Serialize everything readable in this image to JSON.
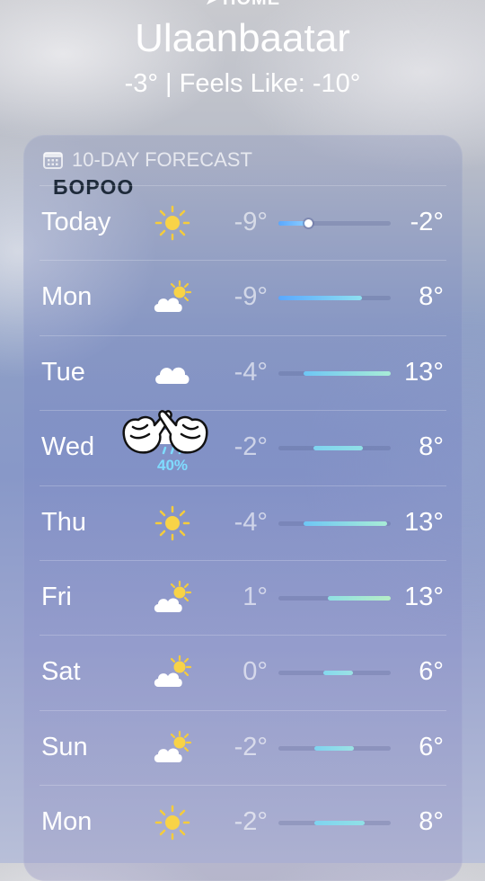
{
  "header": {
    "home_label": "HOME",
    "city": "Ulaanbaatar",
    "current": "-3° | Feels Like: -10°"
  },
  "forecast": {
    "title": "10-DAY FORECAST",
    "overlay_text": "БОРОО",
    "rows": [
      {
        "day": "Today",
        "icon": "sun-icon",
        "low": "-9°",
        "high": "-2°",
        "range_start": 0.0,
        "range_end": 0.27,
        "current_marker": 0.27,
        "colors": [
          "#5aa8ff",
          "#8fd0ff"
        ]
      },
      {
        "day": "Mon",
        "icon": "partly-cloudy-icon",
        "low": "-9°",
        "high": "8°",
        "range_start": 0.0,
        "range_end": 0.74,
        "colors": [
          "#5aa8ff",
          "#8ee0f0"
        ]
      },
      {
        "day": "Tue",
        "icon": "cloud-icon",
        "low": "-4°",
        "high": "13°",
        "range_start": 0.22,
        "range_end": 1.0,
        "colors": [
          "#6ec6f5",
          "#a8ecd6"
        ]
      },
      {
        "day": "Wed",
        "icon": "rain-icon",
        "precip": "40%",
        "low": "-2°",
        "high": "8°",
        "range_start": 0.31,
        "range_end": 0.75,
        "colors": [
          "#7fd3f0",
          "#90e0e6"
        ]
      },
      {
        "day": "Thu",
        "icon": "sun-icon",
        "low": "-4°",
        "high": "13°",
        "range_start": 0.22,
        "range_end": 0.97,
        "colors": [
          "#6ec6f5",
          "#a8ecd6"
        ]
      },
      {
        "day": "Fri",
        "icon": "partly-cloudy-icon",
        "low": "1°",
        "high": "13°",
        "range_start": 0.44,
        "range_end": 1.0,
        "colors": [
          "#8fe0e4",
          "#b6eec6"
        ]
      },
      {
        "day": "Sat",
        "icon": "partly-cloudy-icon",
        "low": "0°",
        "high": "6°",
        "range_start": 0.4,
        "range_end": 0.66,
        "colors": [
          "#85d8ee",
          "#9be2e4"
        ]
      },
      {
        "day": "Sun",
        "icon": "partly-cloudy-icon",
        "low": "-2°",
        "high": "6°",
        "range_start": 0.32,
        "range_end": 0.67,
        "colors": [
          "#7fd3f0",
          "#9be2e4"
        ]
      },
      {
        "day": "Mon",
        "icon": "sun-icon",
        "low": "-2°",
        "high": "8°",
        "range_start": 0.32,
        "range_end": 0.77,
        "colors": [
          "#7fd3f0",
          "#90e0e6"
        ]
      }
    ]
  }
}
